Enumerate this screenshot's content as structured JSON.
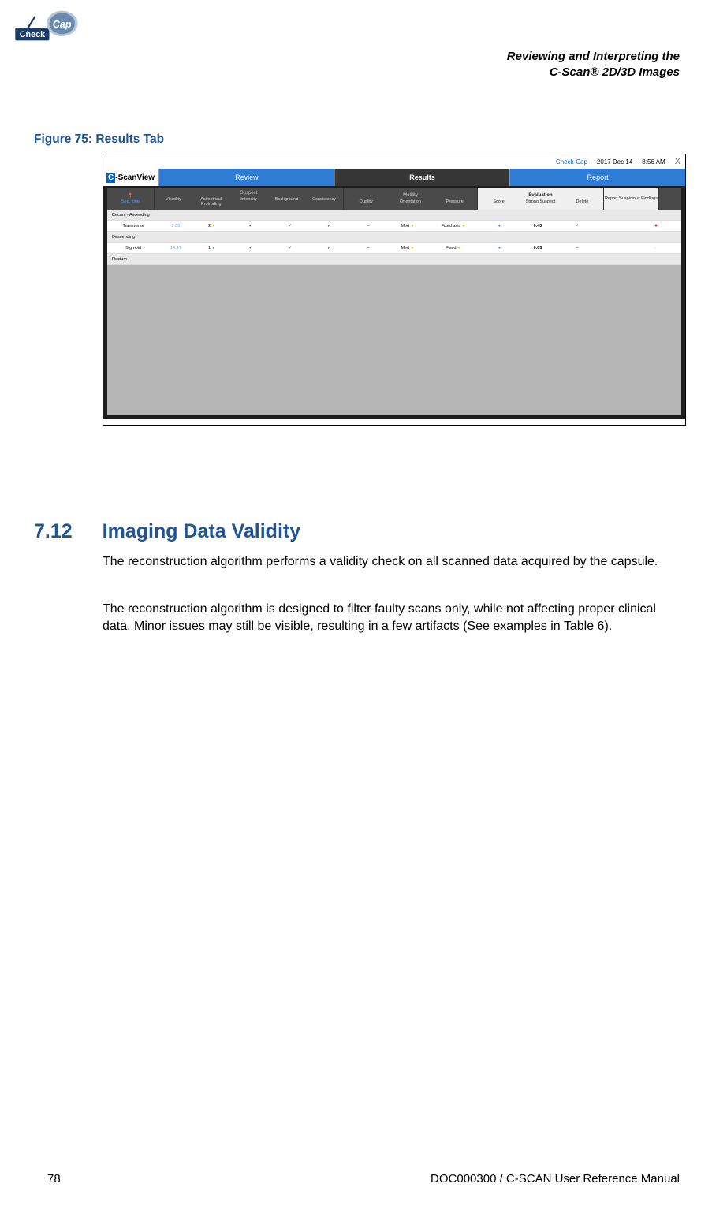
{
  "header": {
    "line1": "Reviewing and Interpreting the",
    "line2": "C-Scan® 2D/3D Images"
  },
  "figure": {
    "caption": "Figure 75: Results Tab"
  },
  "screenshot": {
    "topbar": {
      "brand": "Check-Cap",
      "date": "2017 Dec 14",
      "time": "8:56 AM",
      "close": "X"
    },
    "logo": {
      "c": "C",
      "rest": "-ScanView"
    },
    "tabs": {
      "review": "Review",
      "results": "Results",
      "report": "Report"
    },
    "groups": {
      "suspect": "Suspect",
      "motility": "Motility",
      "evaluation": "Evaluation",
      "report": "Report Suspicious Findings"
    },
    "cols": {
      "pin": "📍",
      "segtime": "Seg. time",
      "visibility": "Visibility",
      "asym": "Asimetrical Protruding",
      "intensity": "Intensity",
      "background": "Background",
      "consistency": "Consistency",
      "quality": "Quality",
      "orientation": "Orientation",
      "pressure": "Pressure",
      "score": "Score",
      "strong": "Strong Suspect",
      "delete": "Delete"
    },
    "rows": {
      "sec1": "Cecum - Ascending",
      "r1": {
        "name": "Transverse",
        "time": "2.30",
        "vis": "2",
        "score": "0.43"
      },
      "sec2": "Descending",
      "r2": {
        "name": "Sigmoid",
        "time": "14.47",
        "vis": "1",
        "score": "0.05"
      },
      "sec3": "Rectum",
      "check": "✓",
      "dash": "–",
      "med": "Med",
      "fixedaxis": "Fixed axis",
      "fixed": "Fixed"
    }
  },
  "section": {
    "number": "7.12",
    "title": "Imaging Data Validity",
    "para1": "The reconstruction algorithm performs a validity check on all scanned data acquired by the capsule.",
    "para2": "The reconstruction algorithm is designed to filter faulty scans only, while not affecting proper clinical data. Minor issues may still be visible, resulting in a few artifacts (See examples in Table 6)."
  },
  "footer": {
    "page": "78",
    "doc": "DOC000300 / C-SCAN User Reference Manual"
  }
}
